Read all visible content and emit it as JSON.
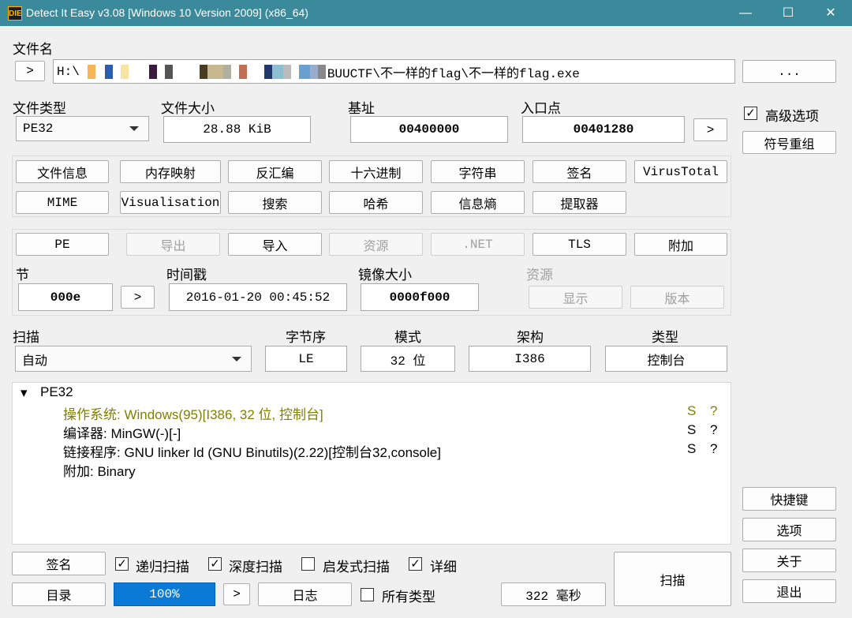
{
  "window": {
    "app_icon": "DIE",
    "title": "Detect It Easy v3.08 [Windows 10 Version 2009] (x86_64)",
    "minimize": "—",
    "maximize": "☐",
    "close": "✕"
  },
  "file": {
    "label": "文件名",
    "nav_button": ">",
    "path_prefix": "H:\\",
    "path_suffix": "BUUCTF\\不一样的flag\\不一样的flag.exe",
    "browse_button": "..."
  },
  "info": {
    "file_type_label": "文件类型",
    "file_type_value": "PE32",
    "file_size_label": "文件大小",
    "file_size_value": "28.88 KiB",
    "base_label": "基址",
    "base_value": "00400000",
    "entry_label": "入口点",
    "entry_value": "00401280",
    "entry_nav": ">"
  },
  "tools_row1": [
    "文件信息",
    "内存映射",
    "反汇编",
    "十六进制",
    "字符串",
    "签名",
    "VirusTotal"
  ],
  "tools_row2": [
    "MIME",
    "Visualisation",
    "搜索",
    "哈希",
    "信息熵",
    "提取器"
  ],
  "pe": {
    "buttons": [
      "PE",
      "导出",
      "导入",
      "资源",
      ".NET",
      "TLS",
      "附加"
    ],
    "section_label": "节",
    "section_value": "000e",
    "section_nav": ">",
    "timestamp_label": "时间戳",
    "timestamp_value": "2016-01-20 00:45:52",
    "image_size_label": "镜像大小",
    "image_size_value": "0000f000",
    "resource_label": "资源",
    "show_button": "显示",
    "version_button": "版本"
  },
  "scan": {
    "label": "扫描",
    "mode_value": "自动",
    "endian_label": "字节序",
    "endian_value": "LE",
    "mode_label": "模式",
    "bits_value": "32 位",
    "arch_label": "架构",
    "arch_value": "I386",
    "type_label": "类型",
    "type_value": "控制台"
  },
  "results": {
    "root": "PE32",
    "items": [
      {
        "text": "操作系统: Windows(95)[I386, 32 位, 控制台]",
        "flag_s": "S",
        "flag_q": "?",
        "color": "#808000"
      },
      {
        "text": "编译器: MinGW(-)[-]",
        "flag_s": "S",
        "flag_q": "?",
        "color": "#000000"
      },
      {
        "text": "链接程序: GNU linker ld (GNU Binutils)(2.22)[控制台32,console]",
        "flag_s": "S",
        "flag_q": "?",
        "color": "#000000"
      },
      {
        "text": "附加: Binary",
        "flag_s": "",
        "flag_q": "",
        "color": "#000000"
      }
    ]
  },
  "bottom": {
    "signature_button": "签名",
    "recursive": {
      "label": "递归扫描",
      "checked": true
    },
    "deep": {
      "label": "深度扫描",
      "checked": true
    },
    "heuristic": {
      "label": "启发式扫描",
      "checked": false
    },
    "verbose": {
      "label": "详细",
      "checked": true
    },
    "directory_button": "目录",
    "progress": "100%",
    "progress_nav": ">",
    "log_button": "日志",
    "all_types": {
      "label": "所有类型",
      "checked": false
    },
    "elapsed": "322 毫秒",
    "scan_button": "扫描"
  },
  "right_panel": {
    "advanced": {
      "label": "高级选项",
      "checked": true
    },
    "demangle_button": "符号重组",
    "shortcuts_button": "快捷键",
    "options_button": "选项",
    "about_button": "关于",
    "exit_button": "退出"
  },
  "colors": {
    "titlebar": "#3a8a9c",
    "progress": "#0a7ad6",
    "os_line": "#808000"
  }
}
